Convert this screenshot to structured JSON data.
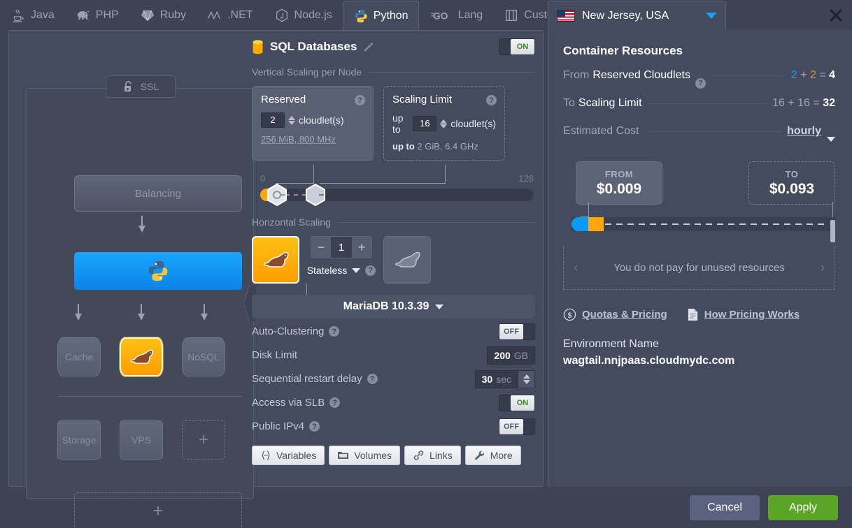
{
  "tabs": [
    {
      "label": "Java",
      "icon": "java-icon",
      "active": false
    },
    {
      "label": "PHP",
      "icon": "php-elephant-icon",
      "active": false
    },
    {
      "label": "Ruby",
      "icon": "ruby-gem-icon",
      "active": false
    },
    {
      "label": ".NET",
      "icon": "dotnet-icon",
      "active": false
    },
    {
      "label": "Node.js",
      "icon": "nodejs-icon",
      "active": false
    },
    {
      "label": "Python",
      "icon": "python-icon",
      "active": true
    },
    {
      "label": "Lang",
      "icon": "go-lang-icon",
      "active": false
    },
    {
      "label": "Custom",
      "icon": "custom-icon",
      "active": false
    }
  ],
  "region": {
    "name": "New Jersey, USA",
    "flag": "usa-flag-icon",
    "caret": "chevron-down-icon"
  },
  "close_icon": "close-icon",
  "topology": {
    "ssl_badge": {
      "label": "SSL",
      "icon": "unlocked-padlock-icon"
    },
    "balancing": "Balancing",
    "app_node": "python-icon",
    "db_nodes": [
      {
        "label": "Cache",
        "selected": false
      },
      {
        "label": "",
        "selected": true,
        "icon": "mariadb-seal-icon"
      },
      {
        "label": "NoSQL",
        "selected": false
      }
    ],
    "extra_nodes": [
      {
        "label": "Storage",
        "dashed": false
      },
      {
        "label": "VPS",
        "dashed": false
      },
      {
        "label": "+",
        "dashed": true
      }
    ],
    "add_node": "+"
  },
  "settings": {
    "title": "SQL Databases",
    "title_icon": "database-cylinder-icon",
    "edit_icon": "pencil-icon",
    "power_toggle": {
      "state": "on",
      "label": "ON"
    },
    "vertical_scaling": {
      "header": "Vertical Scaling per Node",
      "reserved": {
        "title": "Reserved",
        "value": "2",
        "unit": "cloudlet(s)",
        "desc": "256 MiB, 800 MHz",
        "help": "?"
      },
      "scaling_limit": {
        "title": "Scaling Limit",
        "prefix": "up to",
        "value": "16",
        "unit": "cloudlet(s)",
        "desc_prefix": "up to",
        "desc": "2 GiB, 6.4 GHz",
        "help": "?"
      },
      "slider": {
        "min": "0",
        "max": "128"
      }
    },
    "horizontal_scaling": {
      "header": "Horizontal Scaling",
      "count": "1",
      "minus": "−",
      "plus": "+",
      "mode": "Stateless",
      "mode_help": "?",
      "version": "MariaDB 10.3.39",
      "node_icon": "mariadb-seal-icon"
    },
    "options": [
      {
        "label": "Auto-Clustering",
        "help": "?",
        "control": "toggle",
        "state": "off",
        "state_label": "OFF"
      },
      {
        "label": "Disk Limit",
        "help": "",
        "control": "value",
        "value": "200",
        "unit": "GB"
      },
      {
        "label": "Sequential restart delay",
        "help": "?",
        "control": "spinner",
        "value": "30",
        "unit": "sec"
      },
      {
        "label": "Access via SLB",
        "help": "?",
        "control": "toggle",
        "state": "on",
        "state_label": "ON"
      },
      {
        "label": "Public IPv4",
        "help": "?",
        "control": "toggle",
        "state": "off",
        "state_label": "OFF"
      }
    ],
    "buttons": [
      {
        "label": "Variables",
        "icon": "braces-icon"
      },
      {
        "label": "Volumes",
        "icon": "folder-icon"
      },
      {
        "label": "Links",
        "icon": "link-icon"
      },
      {
        "label": "More",
        "icon": "wrench-icon"
      }
    ]
  },
  "resources": {
    "title": "Container Resources",
    "from": {
      "lead": "From",
      "label": "Reserved Cloudlets",
      "help": "?",
      "a": "2",
      "plus": "+",
      "b": "2",
      "eq": "=",
      "total": "4"
    },
    "to": {
      "lead": "To",
      "label": "Scaling Limit",
      "a": "16",
      "plus": "+",
      "b": "16",
      "eq": "=",
      "total": "32"
    },
    "cost": {
      "label": "Estimated Cost",
      "period": "hourly",
      "caret": "chevron-down-icon"
    },
    "price_from": {
      "label": "FROM",
      "value": "$0.009"
    },
    "price_to": {
      "label": "TO",
      "value": "$0.093"
    },
    "unused_note": "You do not pay for unused resources",
    "nav_prev": "‹",
    "nav_next": "›",
    "links": [
      {
        "label": "Quotas & Pricing",
        "icon": "dollar-circle-icon"
      },
      {
        "label": "How Pricing Works",
        "icon": "document-icon"
      }
    ],
    "env_label": "Environment Name",
    "env_name": "wagtail.nnjpaas.cloudmydc.com"
  },
  "footer": {
    "cancel": "Cancel",
    "apply": "Apply"
  },
  "colors": {
    "accent_blue": "#1f9ff0",
    "accent_orange": "#ffa60a",
    "apply_green": "#5aa526",
    "panel": "#454b5e",
    "background": "#3d4355"
  }
}
